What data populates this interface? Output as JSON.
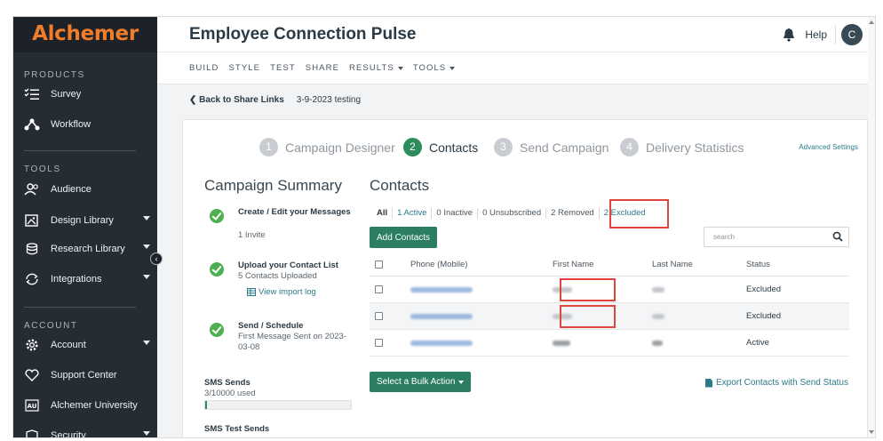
{
  "sidebar": {
    "logo": "Alchemer",
    "sections": {
      "products": "PRODUCTS",
      "tools": "TOOLS",
      "account": "ACCOUNT"
    },
    "products": [
      {
        "label": "Survey",
        "icon": "checklist-icon"
      },
      {
        "label": "Workflow",
        "icon": "workflow-icon"
      }
    ],
    "tools": [
      {
        "label": "Audience",
        "icon": "audience-icon"
      },
      {
        "label": "Design Library",
        "icon": "image-icon"
      },
      {
        "label": "Research Library",
        "icon": "database-icon"
      },
      {
        "label": "Integrations",
        "icon": "sync-icon"
      }
    ],
    "account": [
      {
        "label": "Account",
        "icon": "gear-icon"
      },
      {
        "label": "Support Center",
        "icon": "heart-icon"
      },
      {
        "label": "Alchemer University",
        "icon": "university-icon"
      },
      {
        "label": "Security",
        "icon": "shield-icon"
      }
    ],
    "accent": "#f07d2c"
  },
  "header": {
    "title": "Employee Connection Pulse",
    "help": "Help",
    "avatar": "C"
  },
  "menu": [
    "BUILD",
    "STYLE",
    "TEST",
    "SHARE",
    "RESULTS",
    "TOOLS"
  ],
  "breadcrumb": {
    "back": "Back to Share Links",
    "current": "3-9-2023 testing"
  },
  "steps": [
    {
      "num": "1",
      "label": "Campaign Designer"
    },
    {
      "num": "2",
      "label": "Contacts"
    },
    {
      "num": "3",
      "label": "Send Campaign"
    },
    {
      "num": "4",
      "label": "Delivery Statistics"
    }
  ],
  "advanced_settings": "Advanced Settings",
  "summary": {
    "title": "Campaign Summary",
    "items": [
      {
        "head": "Create / Edit your Messages",
        "sub": "1 Invite"
      },
      {
        "head": "Upload your Contact List",
        "sub": "5 Contacts Uploaded",
        "link": "View import log"
      },
      {
        "head": "Send / Schedule",
        "sub": "First Message Sent on 2023-03-08"
      }
    ],
    "sms_sends_label": "SMS Sends",
    "sms_sends_used": "3/10000 used",
    "sms_sends_fraction": 0.0003,
    "sms_test_label": "SMS Test Sends"
  },
  "contacts": {
    "title": "Contacts",
    "filters": [
      "All",
      "1 Active",
      "0 Inactive",
      "0 Unsubscribed",
      "2 Removed",
      "2 Excluded"
    ],
    "add_button": "Add Contacts",
    "search_placeholder": "search",
    "columns": [
      "Phone (Mobile)",
      "First Name",
      "Last Name",
      "Status"
    ],
    "rows": [
      {
        "status": "Excluded"
      },
      {
        "status": "Excluded"
      },
      {
        "status": "Active"
      }
    ],
    "bulk_button": "Select a Bulk Action",
    "export_link": "Export Contacts with Send Status"
  },
  "colors": {
    "primary": "#2b7d63",
    "highlight": "#e0463b",
    "link": "#2c7a8a"
  }
}
